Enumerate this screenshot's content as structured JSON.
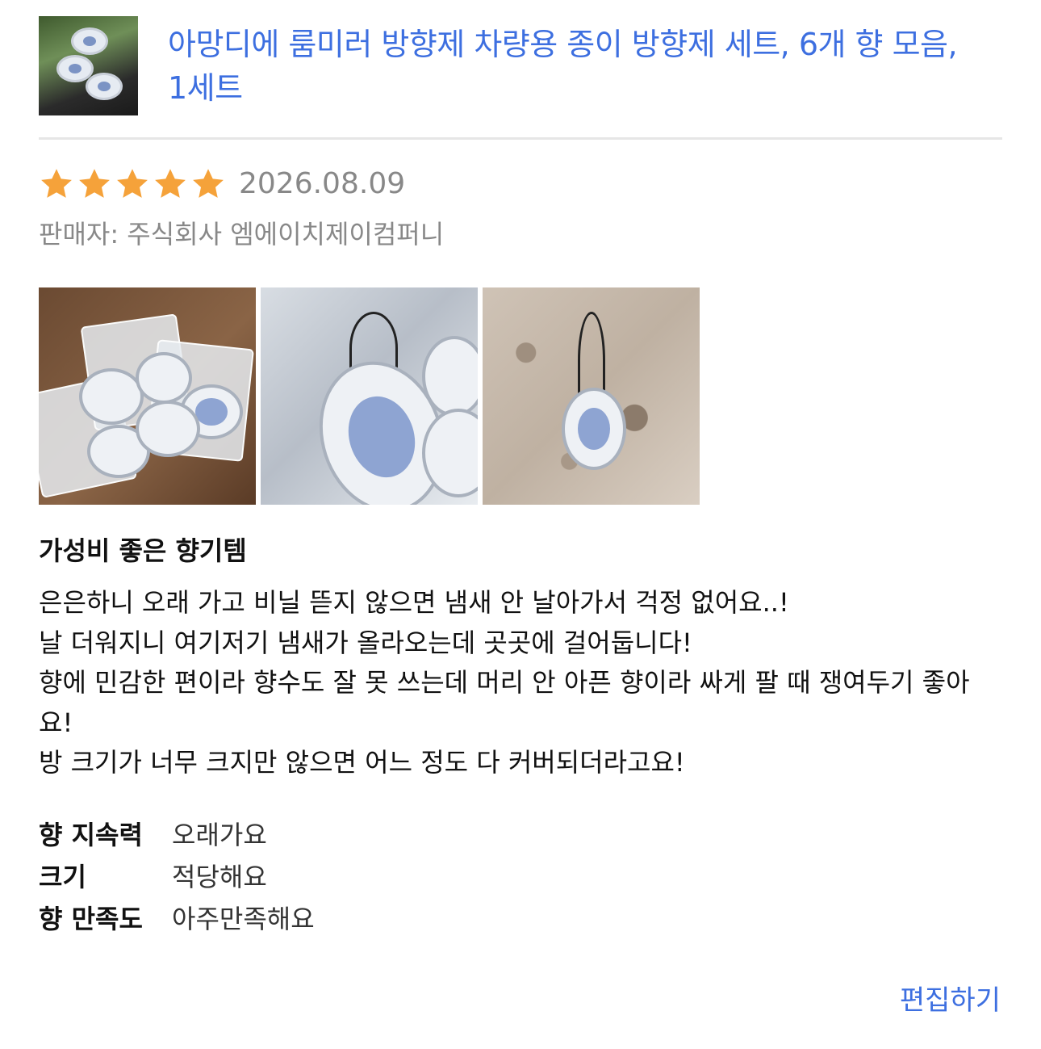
{
  "product": {
    "title": "아망디에 룸미러 방향제 차량용 종이 방향제 세트, 6개 향 모음, 1세트"
  },
  "review": {
    "rating": 5,
    "rating_max": 5,
    "date": "2026.08.09",
    "seller": "판매자: 주식회사 엠에이치제이컴퍼니",
    "photo_count": 3,
    "headline": "가성비 좋은 향기템",
    "body_lines": [
      "은은하니 오래 가고 비닐 뜯지 않으면 냄새 안 날아가서 걱정 없어요..!",
      "날 더워지니 여기저기 냄새가 올라오는데 곳곳에 걸어둡니다!",
      "향에 민감한 편이라 향수도 잘 못 쓰는데 머리 안 아픈 향이라 싸게 팔 때 쟁여두기 좋아요!",
      "방 크기가 너무 크지만 않으면 어느 정도 다 커버되더라고요!"
    ],
    "attributes": [
      {
        "key": "향 지속력",
        "value": "오래가요"
      },
      {
        "key": "크기",
        "value": "적당해요"
      },
      {
        "key": "향 만족도",
        "value": "아주만족해요"
      }
    ]
  },
  "actions": {
    "edit_label": "편집하기"
  },
  "colors": {
    "link": "#3d6fe0",
    "star": "#f5a23a",
    "muted_text": "#888888"
  }
}
